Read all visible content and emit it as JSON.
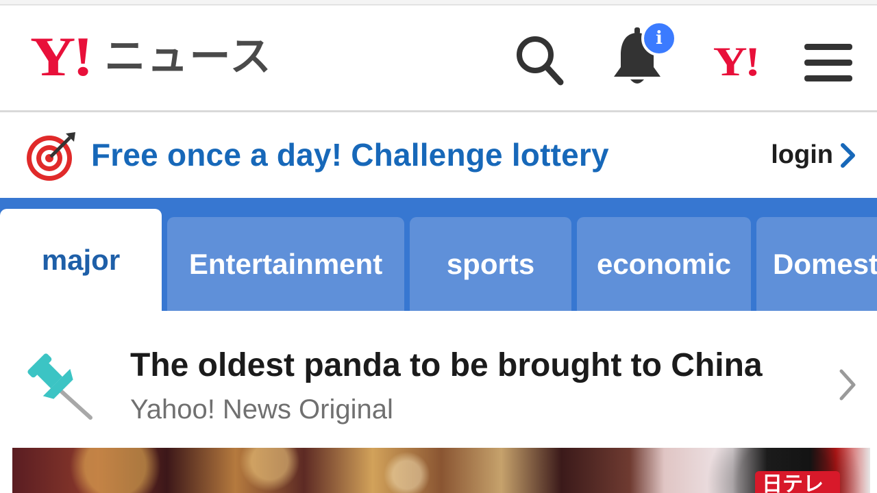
{
  "header": {
    "logo_mark": "Y!",
    "logo_title": "ニュース",
    "notification_badge": "i",
    "yahoo_mark": "Y!"
  },
  "promo": {
    "text": "Free once a day! Challenge lottery",
    "login_label": "login"
  },
  "tabs": [
    {
      "label": "major",
      "active": true
    },
    {
      "label": "Entertainment",
      "active": false
    },
    {
      "label": "sports",
      "active": false
    },
    {
      "label": "economic",
      "active": false
    },
    {
      "label": "Domest",
      "active": false
    }
  ],
  "news": {
    "title": "The oldest panda to be brought to China",
    "source": "Yahoo! News Original"
  },
  "hero": {
    "channel_logo": "日テレ"
  },
  "colors": {
    "brand_red": "#e8103a",
    "link_blue": "#1768b9",
    "tabbar_blue": "#3777d1",
    "tab_blue": "#5f90d9",
    "badge_blue": "#3b7bff",
    "pin_teal": "#3cc4c4"
  },
  "icons": {
    "search": "search-icon",
    "bell": "bell-icon",
    "menu": "hamburger-menu-icon",
    "target": "target-arrow-icon",
    "pin": "pushpin-icon",
    "chevron": "chevron-right-icon"
  }
}
